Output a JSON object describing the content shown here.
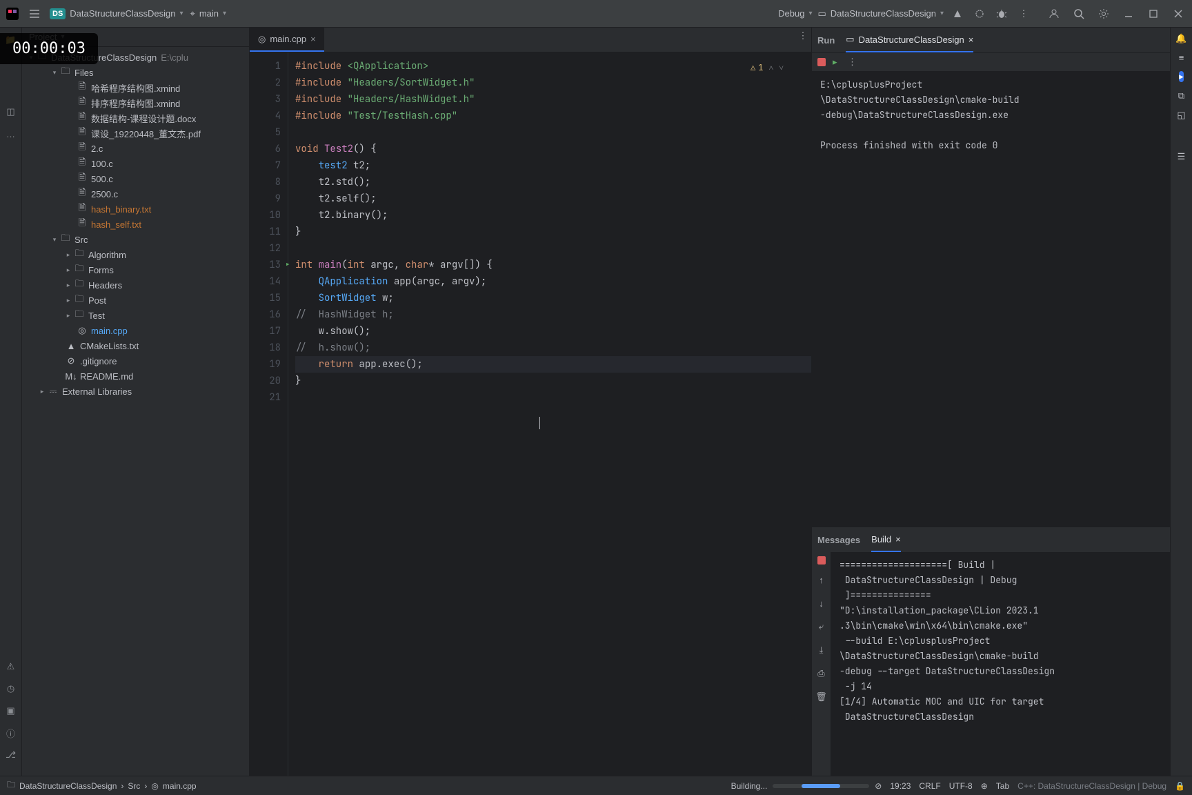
{
  "overlay": {
    "timer": "00:00:03"
  },
  "topbar": {
    "project_name": "DataStructureClassDesign",
    "run_config": "main",
    "debug_label": "Debug",
    "target_label": "DataStructureClassDesign"
  },
  "project_panel": {
    "title": "Project",
    "root": "DataStructureClassDesign",
    "root_path": "E:\\cplu",
    "files_label": "Files",
    "files": [
      "哈希程序结构图.xmind",
      "排序程序结构图.xmind",
      "数据结构-课程设计题.docx",
      "课设_19220448_董文杰.pdf",
      "2.c",
      "100.c",
      "500.c",
      "2500.c",
      "hash_binary.txt",
      "hash_self.txt"
    ],
    "src_label": "Src",
    "src_dirs": [
      "Algorithm",
      "Forms",
      "Headers",
      "Post",
      "Test"
    ],
    "main_file": "main.cpp",
    "root_files": [
      "CMakeLists.txt",
      ".gitignore",
      "README.md"
    ],
    "external": "External Libraries"
  },
  "editor": {
    "tab": "main.cpp",
    "warning_count": "1",
    "lines": [
      {
        "n": "1",
        "html": "<span class='kw'>#include</span> <span class='str'>&lt;QApplication&gt;</span>"
      },
      {
        "n": "2",
        "html": "<span class='kw'>#include</span> <span class='str'>\"Headers/SortWidget.h\"</span>"
      },
      {
        "n": "3",
        "html": "<span class='kw'>#include</span> <span class='str'>\"Headers/HashWidget.h\"</span>"
      },
      {
        "n": "4",
        "html": "<span class='kw'>#include</span> <span class='str'>\"Test/TestHash.cpp\"</span>"
      },
      {
        "n": "5",
        "html": ""
      },
      {
        "n": "6",
        "html": "<span class='kw'>void</span> <span class='fn'>Test2</span>() {"
      },
      {
        "n": "7",
        "html": "    <span class='typ'>test2</span> t2;"
      },
      {
        "n": "8",
        "html": "    t2.std();"
      },
      {
        "n": "9",
        "html": "    t2.self();"
      },
      {
        "n": "10",
        "html": "    t2.binary();"
      },
      {
        "n": "11",
        "html": "}"
      },
      {
        "n": "12",
        "html": ""
      },
      {
        "n": "13",
        "html": "<span class='kw'>int</span> <span class='fn'>main</span>(<span class='kw'>int</span> argc, <span class='kw'>char</span>* argv[]) {",
        "run": true
      },
      {
        "n": "14",
        "html": "    <span class='typ'>QApplication</span> app(argc, argv);"
      },
      {
        "n": "15",
        "html": "    <span class='typ'>SortWidget</span> w;"
      },
      {
        "n": "16",
        "html": "<span class='com'>//  HashWidget h;</span>"
      },
      {
        "n": "17",
        "html": "    w.show();"
      },
      {
        "n": "18",
        "html": "<span class='com'>//  h.show();</span>"
      },
      {
        "n": "19",
        "html": "    <span class='kw'>return</span> app.exec();",
        "cur": true
      },
      {
        "n": "20",
        "html": "}"
      },
      {
        "n": "21",
        "html": ""
      }
    ]
  },
  "run_panel": {
    "run_tab": "Run",
    "config_tab": "DataStructureClassDesign",
    "output": "E:\\cplusplusProject\n\\DataStructureClassDesign\\cmake-build\n-debug\\DataStructureClassDesign.exe\n\nProcess finished with exit code 0"
  },
  "build_panel": {
    "messages_tab": "Messages",
    "build_tab": "Build",
    "output": "====================[ Build |\n DataStructureClassDesign | Debug\n ]===============\n\"D:\\installation_package\\CLion 2023.1\n.3\\bin\\cmake\\win\\x64\\bin\\cmake.exe\"\n --build E:\\cplusplusProject\n\\DataStructureClassDesign\\cmake-build\n-debug --target DataStructureClassDesign\n -j 14\n[1/4] Automatic MOC and UIC for target\n DataStructureClassDesign"
  },
  "status": {
    "crumb1": "DataStructureClassDesign",
    "crumb2": "Src",
    "crumb3": "main.cpp",
    "building": "Building...",
    "pos": "19:23",
    "eol": "CRLF",
    "enc": "UTF-8",
    "indent": "Tab",
    "mode": "C++: DataStructureClassDesign | Debug"
  }
}
